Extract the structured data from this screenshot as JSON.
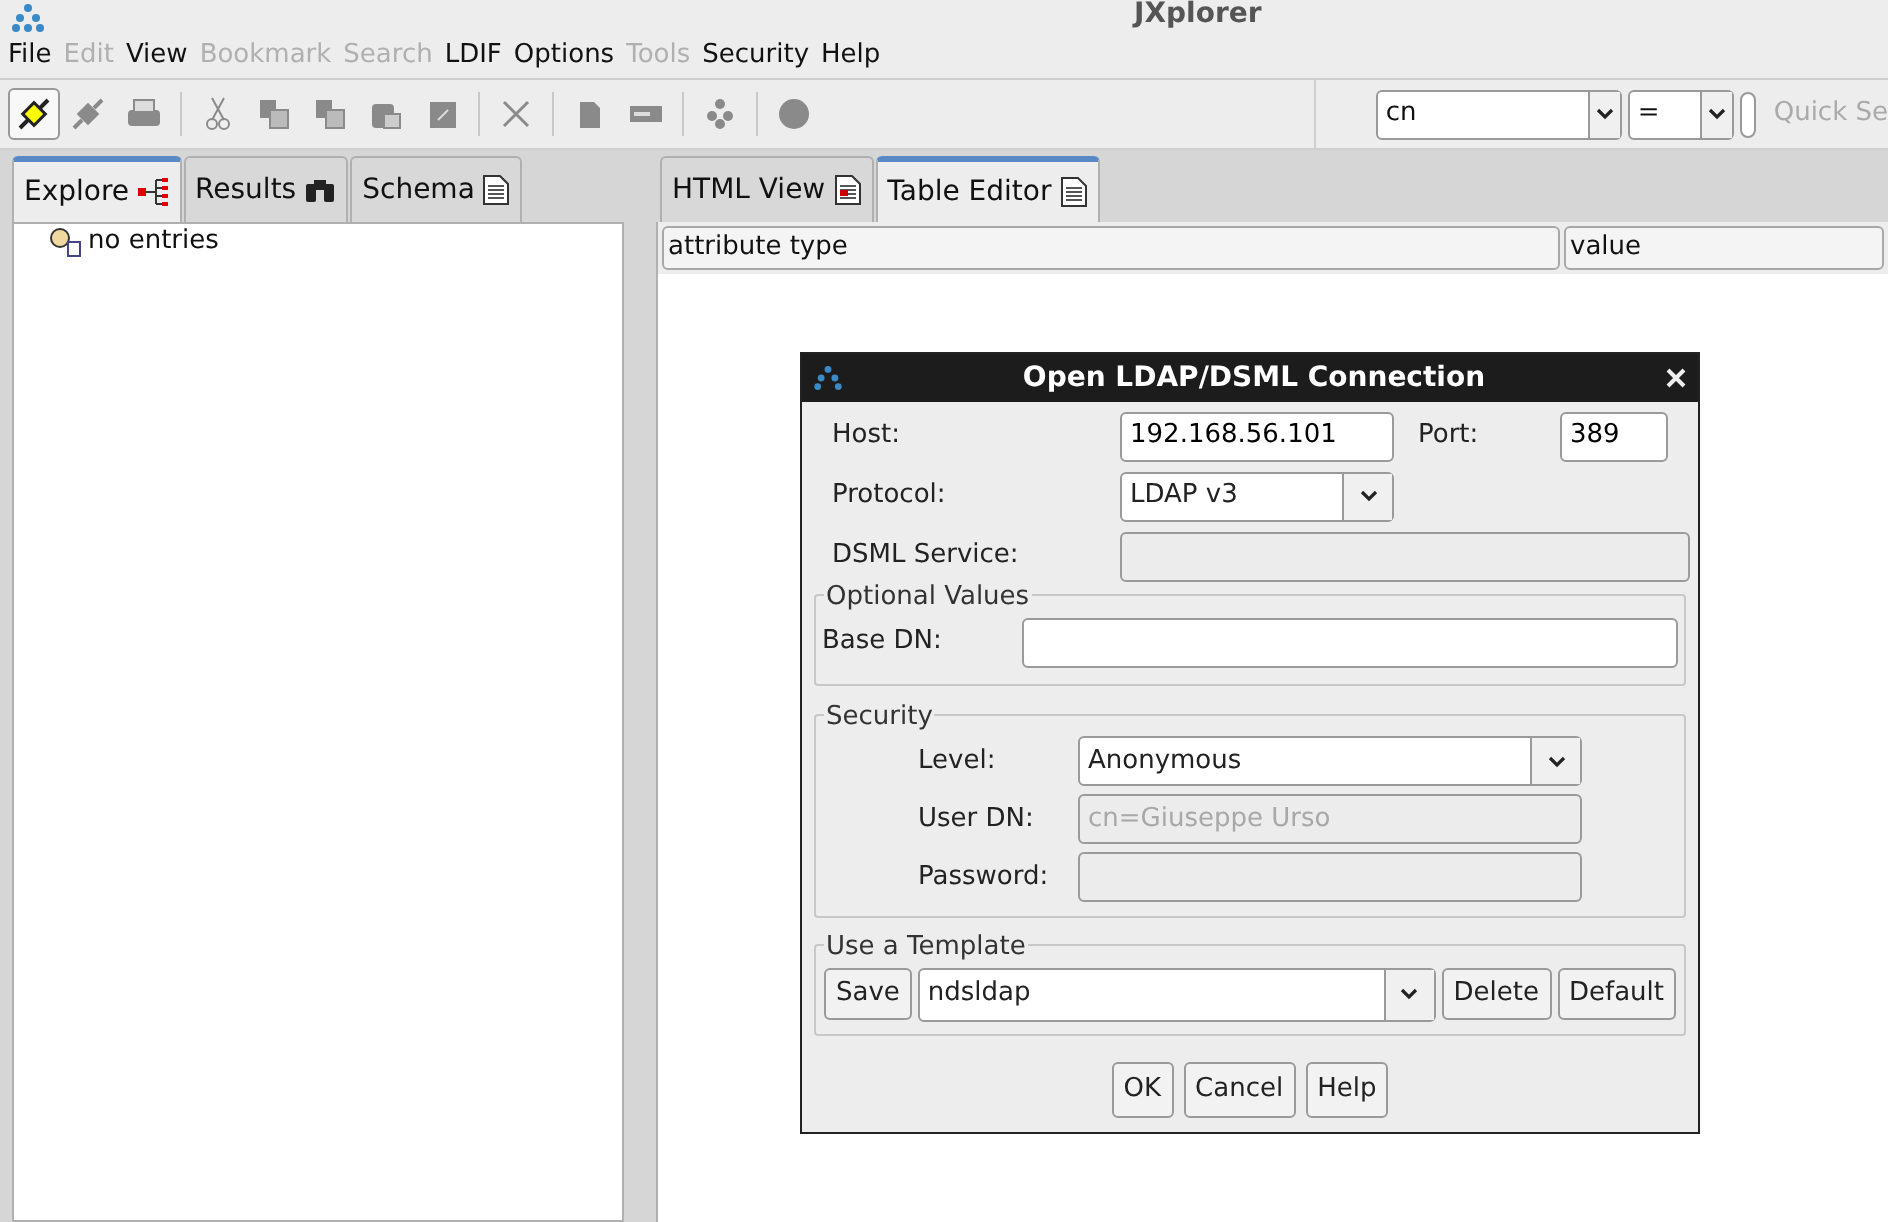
{
  "window": {
    "title": "JXplorer"
  },
  "menu": [
    {
      "label": "File",
      "disabled": false
    },
    {
      "label": "Edit",
      "disabled": true
    },
    {
      "label": "View",
      "disabled": false
    },
    {
      "label": "Bookmark",
      "disabled": true
    },
    {
      "label": "Search",
      "disabled": true
    },
    {
      "label": "LDIF",
      "disabled": false
    },
    {
      "label": "Options",
      "disabled": false
    },
    {
      "label": "Tools",
      "disabled": true
    },
    {
      "label": "Security",
      "disabled": false
    },
    {
      "label": "Help",
      "disabled": false
    }
  ],
  "toolbar": {
    "connect_pressed": true,
    "quick_search": {
      "attribute": "cn",
      "operator": "=",
      "label": "Quick Se"
    }
  },
  "left_tabs": [
    {
      "label": "Explore",
      "selected": true
    },
    {
      "label": "Results",
      "selected": false
    },
    {
      "label": "Schema",
      "selected": false
    }
  ],
  "tree": {
    "items": [
      "no entries"
    ]
  },
  "right_tabs": [
    {
      "label": "HTML View",
      "selected": false
    },
    {
      "label": "Table Editor",
      "selected": true
    }
  ],
  "table": {
    "columns": [
      "attribute type",
      "value"
    ]
  },
  "dialog": {
    "title": "Open LDAP/DSML Connection",
    "host": {
      "label": "Host:",
      "value": "192.168.56.101"
    },
    "port": {
      "label": "Port:",
      "value": "389"
    },
    "protocol": {
      "label": "Protocol:",
      "value": "LDAP v3"
    },
    "dsml": {
      "label": "DSML Service:",
      "disabled": true
    },
    "optional": {
      "title": "Optional Values",
      "base_dn": {
        "label": "Base DN:"
      }
    },
    "security": {
      "title": "Security",
      "level": {
        "label": "Level:",
        "value": "Anonymous"
      },
      "user_dn": {
        "label": "User DN:",
        "value": "cn=Giuseppe Urso",
        "disabled": true
      },
      "password": {
        "label": "Password:",
        "disabled": true
      }
    },
    "template": {
      "title": "Use a Template",
      "save": "Save",
      "value": "ndsldap",
      "delete": "Delete",
      "default": "Default"
    },
    "buttons": [
      "OK",
      "Cancel",
      "Help"
    ]
  }
}
